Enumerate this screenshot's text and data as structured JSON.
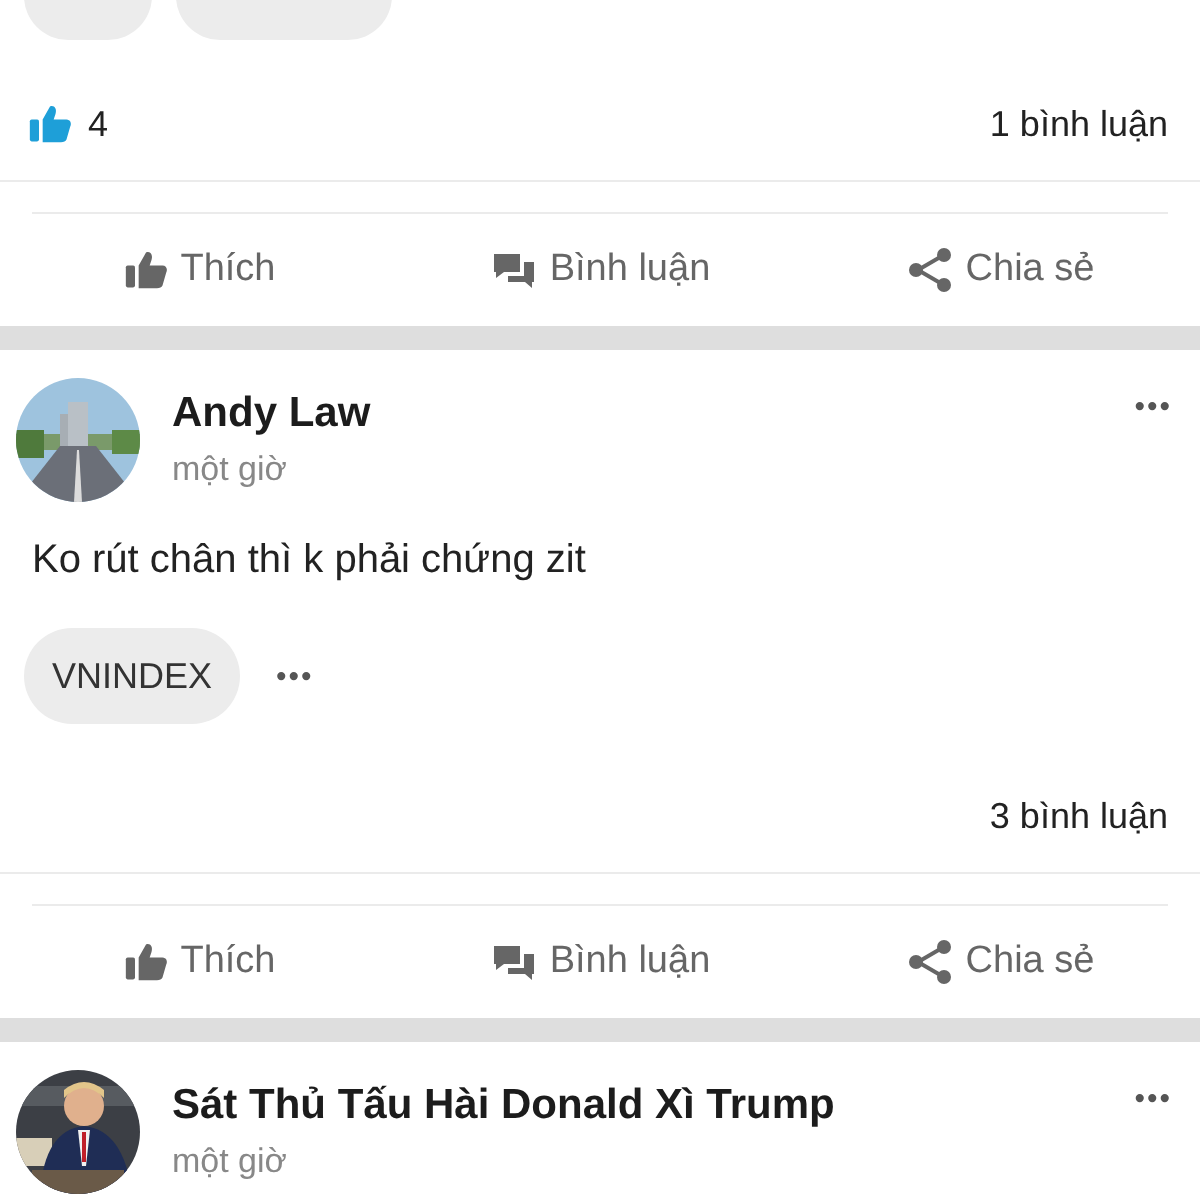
{
  "posts": [
    {
      "tags": [
        {
          "kind": "cut"
        },
        {
          "kind": "cut"
        }
      ],
      "likes": "4",
      "comments": "1 bình luận",
      "actions": [
        {
          "kind": "like",
          "label": "Thích"
        },
        {
          "kind": "comment",
          "label": "Bình luận"
        },
        {
          "kind": "share",
          "label": "Chia sẻ"
        }
      ]
    },
    {
      "avatar": {
        "kind": "picture"
      },
      "author": "Andy Law",
      "time": "một giờ",
      "menu": "•••",
      "text": "Ko rút chân thì k phải chứng zit",
      "tags": [
        {
          "kind": "tag",
          "label": "VNINDEX"
        }
      ],
      "tag_menu": "•••",
      "comments": "3 bình luận",
      "actions": [
        {
          "kind": "like",
          "label": "Thích"
        },
        {
          "kind": "comment",
          "label": "Bình luận"
        },
        {
          "kind": "share",
          "label": "Chia sẻ"
        }
      ]
    },
    {
      "avatar": {
        "kind": "picture"
      },
      "author": "Sát Thủ Tấu Hài Donald Xì Trump",
      "time": "một giờ",
      "menu": "•••"
    }
  ]
}
